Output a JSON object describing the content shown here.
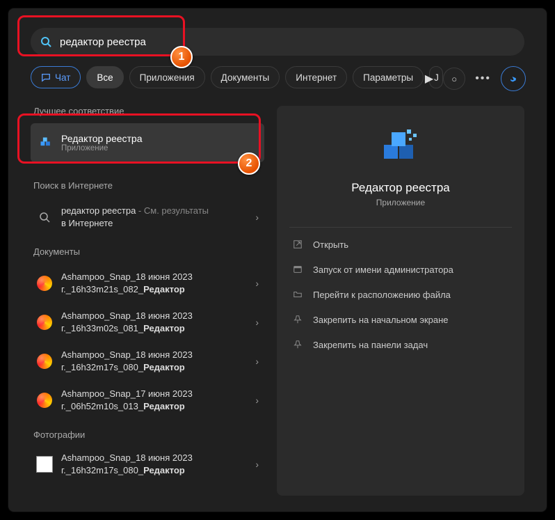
{
  "search": {
    "value": "редактор реестра"
  },
  "tabs": {
    "chat": "Чат",
    "all": "Все",
    "apps": "Приложения",
    "docs": "Документы",
    "web": "Интернет",
    "settings": "Параметры"
  },
  "sections": {
    "best_match": "Лучшее соответствие",
    "web_search": "Поиск в Интернете",
    "documents": "Документы",
    "photos": "Фотографии"
  },
  "best_match": {
    "title": "Редактор реестра",
    "subtitle": "Приложение"
  },
  "web_item": {
    "line1_a": "редактор реестра",
    "line1_b": " - См. результаты",
    "line2": "в Интернете"
  },
  "docs": [
    {
      "l1": "Ashampoo_Snap_18 июня 2023",
      "l2a": "г._16h33m21s_082_",
      "l2b": "Редактор"
    },
    {
      "l1": "Ashampoo_Snap_18 июня 2023",
      "l2a": "г._16h33m02s_081_",
      "l2b": "Редактор"
    },
    {
      "l1": "Ashampoo_Snap_18 июня 2023",
      "l2a": "г._16h32m17s_080_",
      "l2b": "Редактор"
    },
    {
      "l1": "Ashampoo_Snap_17 июня 2023",
      "l2a": "г._06h52m10s_013_",
      "l2b": "Редактор"
    }
  ],
  "photos": [
    {
      "l1": "Ashampoo_Snap_18 июня 2023",
      "l2a": "г._16h32m17s_080_",
      "l2b": "Редактор"
    }
  ],
  "detail": {
    "title": "Редактор реестра",
    "subtitle": "Приложение",
    "actions": {
      "open": "Открыть",
      "admin": "Запуск от имени администратора",
      "location": "Перейти к расположению файла",
      "pin_start": "Закрепить на начальном экране",
      "pin_taskbar": "Закрепить на панели задач"
    }
  },
  "annotations": {
    "badge1": "1",
    "badge2": "2"
  }
}
